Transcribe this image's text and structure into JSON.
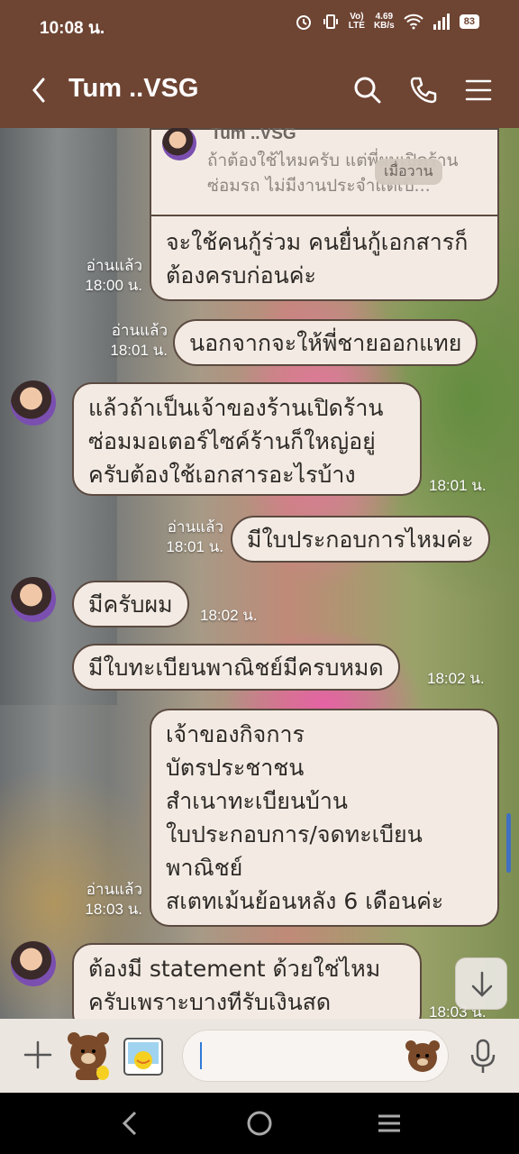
{
  "status": {
    "time": "10:08 น.",
    "net_line1": "4.69",
    "net_line2": "KB/s",
    "battery": "83"
  },
  "header": {
    "title": "Tum ..VSG"
  },
  "reply": {
    "name": "Tum ..VSG",
    "text": "ถ้าต้องใช้ไหมครับ แต่พี่ผมเปิดร้านซ่อมรถ ไม่มีงานประจำแต่เปิ...",
    "badge": "เมื่อวาน"
  },
  "messages": [
    {
      "text": "จะใช้คนกู้ร่วม คนยื่นกู้เอกสารก็\nต้องครบก่อนค่ะ",
      "read": "อ่านแล้ว",
      "time": "18:00 น."
    },
    {
      "text": "นอกจากจะให้พี่ชายออกแทย",
      "read": "อ่านแล้ว",
      "time": "18:01 น."
    },
    {
      "text": "แล้วถ้าเป็นเจ้าของร้านเปิดร้าน\nซ่อมมอเตอร์ไซค์ร้านก็ใหญ่อยู่\nครับต้องใช้เอกสารอะไรบ้าง",
      "time": "18:01 น."
    },
    {
      "text": "มีใบประกอบการไหมค่ะ",
      "read": "อ่านแล้ว",
      "time": "18:01 น."
    },
    {
      "text": "มีครับผม",
      "time": "18:02 น."
    },
    {
      "text": "มีใบทะเบียนพาณิชย์มีครบหมด",
      "time": "18:02 น."
    },
    {
      "text": "เจ้าของกิจการ\nบัตรประชาชน\nสำเนาทะเบียนบ้าน\nใบประกอบการ/จดทะเบียน\nพาณิชย์\nสเตทเม้นย้อนหลัง 6 เดือนค่ะ",
      "read": "อ่านแล้ว",
      "time": "18:03 น."
    },
    {
      "text": "ต้องมี statement ด้วยใช่ไหม\nครับเพราะบางทีรับเงินสด",
      "time": "18:03 น."
    }
  ],
  "input": {
    "placeholder": ""
  },
  "colors": {
    "header": "#6e4433",
    "bubble": "#f3ebe3",
    "bubble_border": "#5b4a40"
  },
  "icons": [
    "back-icon",
    "search-icon",
    "phone-icon",
    "menu-icon",
    "plus-icon",
    "sticker-icon",
    "emoji-icon",
    "mic-icon",
    "scroll-down-icon"
  ]
}
